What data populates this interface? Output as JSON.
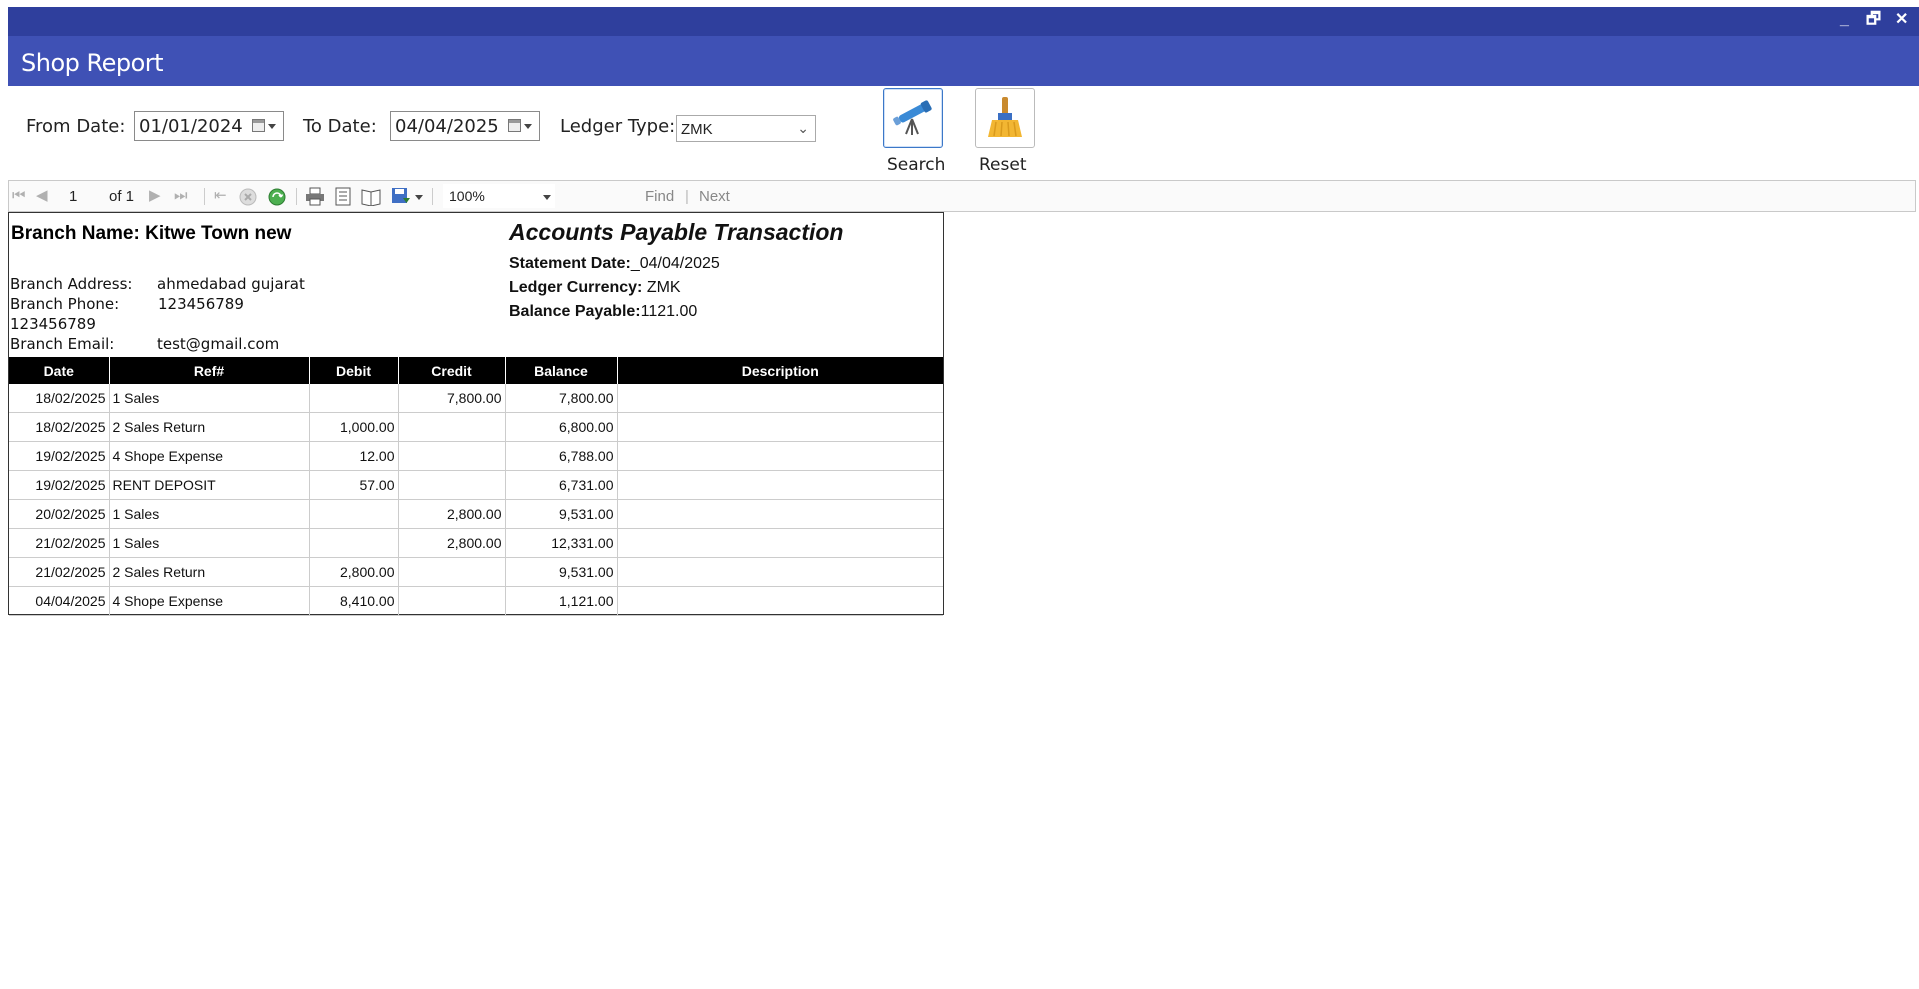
{
  "window": {
    "title": "Shop Report",
    "controls": [
      "_",
      "🗗",
      "✕"
    ]
  },
  "filters": {
    "from_label": "From Date:",
    "from_value": "01/01/2024",
    "to_label": "To Date:",
    "to_value": "04/04/2025",
    "ledger_label": "Ledger Type:",
    "ledger_value": "ZMK",
    "search_label": "Search",
    "reset_label": "Reset"
  },
  "viewer": {
    "page": "1",
    "of_pages": "of 1",
    "zoom": "100%",
    "find_label": "Find",
    "sep": "|",
    "next_label": "Next"
  },
  "report": {
    "branch_name": "Branch Name: Kitwe Town new",
    "address_label": "Branch Address:",
    "address_value": "ahmedabad gujarat",
    "phone_label": "Branch Phone:",
    "phone_value": "123456789",
    "phone_value2": "123456789",
    "email_label": "Branch Email:",
    "email_value": "test@gmail.com",
    "title": "Accounts Payable Transaction",
    "statement_date_label": "Statement Date:",
    "statement_date_value": "_04/04/2025",
    "currency_label": "Ledger Currency:",
    "currency_value": " ZMK",
    "balance_label": "Balance Payable:",
    "balance_value": "1121.00",
    "columns": [
      "Date",
      "Ref#",
      "Debit",
      "Credit",
      "Balance",
      "Description"
    ],
    "rows": [
      {
        "date": "18/02/2025",
        "ref": "1 Sales",
        "debit": "",
        "credit": "7,800.00",
        "balance": "7,800.00",
        "desc": ""
      },
      {
        "date": "18/02/2025",
        "ref": "2 Sales Return",
        "debit": "1,000.00",
        "credit": "",
        "balance": "6,800.00",
        "desc": ""
      },
      {
        "date": "19/02/2025",
        "ref": "4 Shope Expense",
        "debit": "12.00",
        "credit": "",
        "balance": "6,788.00",
        "desc": ""
      },
      {
        "date": "19/02/2025",
        "ref": "RENT DEPOSIT",
        "debit": "57.00",
        "credit": "",
        "balance": "6,731.00",
        "desc": ""
      },
      {
        "date": "20/02/2025",
        "ref": "1 Sales",
        "debit": "",
        "credit": "2,800.00",
        "balance": "9,531.00",
        "desc": ""
      },
      {
        "date": "21/02/2025",
        "ref": "1 Sales",
        "debit": "",
        "credit": "2,800.00",
        "balance": "12,331.00",
        "desc": ""
      },
      {
        "date": "21/02/2025",
        "ref": "2 Sales Return",
        "debit": "2,800.00",
        "credit": "",
        "balance": "9,531.00",
        "desc": ""
      },
      {
        "date": "04/04/2025",
        "ref": "4 Shope Expense",
        "debit": "8,410.00",
        "credit": "",
        "balance": "1,121.00",
        "desc": ""
      }
    ]
  },
  "colors": {
    "titlebar": "#2f3f9d",
    "header": "#3f51b5",
    "grid_header": "#000000"
  }
}
